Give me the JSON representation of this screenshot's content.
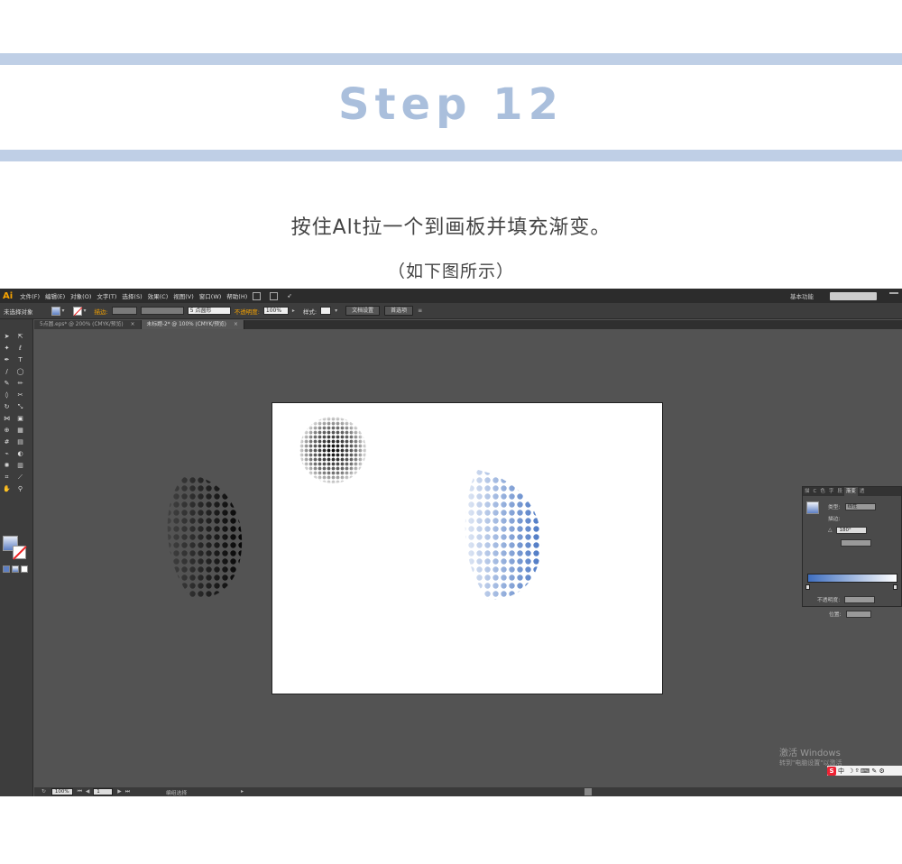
{
  "header": {
    "title": "Step 12",
    "caption": "按住Alt拉一个到画板并填充渐变。",
    "subcaption": "（如下图所示）"
  },
  "app": {
    "logo": "Ai",
    "menu": [
      "文件(F)",
      "编辑(E)",
      "对象(O)",
      "文字(T)",
      "选择(S)",
      "效果(C)",
      "视图(V)",
      "窗口(W)",
      "帮助(H)"
    ],
    "workspace": "基本功能"
  },
  "control_bar": {
    "selection": "未选择对象",
    "stroke_label": "描边:",
    "point_value": "5 点圆形",
    "opacity_label": "不透明度:",
    "opacity_value": "100%",
    "style_label": "样式:",
    "doc_setup": "文档设置",
    "prefs": "首选项"
  },
  "tabs": [
    {
      "label": "5点圆.eps* @ 200% (CMYK/预览)",
      "active": false
    },
    {
      "label": "未标题-2* @ 100% (CMYK/预览)",
      "active": true
    }
  ],
  "gradient_panel": {
    "tabs": [
      "描",
      "C",
      "色",
      "字",
      "段",
      "渐变",
      "透"
    ],
    "type_label": "类型:",
    "type_value": "线性",
    "stroke_label": "描边:",
    "angle_value": "180°",
    "opacity_label": "不透明度:",
    "position_label": "位置:"
  },
  "status": {
    "zoom": "100%",
    "page": "1",
    "mode": "编组选择"
  },
  "watermark": {
    "line1": "激活 Windows",
    "line2": "转到\"电脑设置\"以激活"
  },
  "ime": {
    "label": "中"
  },
  "colors": {
    "band": "#bfcfe6",
    "title": "#aabfdc",
    "gradient_start": "#3f6fc0",
    "gradient_end": "#ffffff"
  }
}
